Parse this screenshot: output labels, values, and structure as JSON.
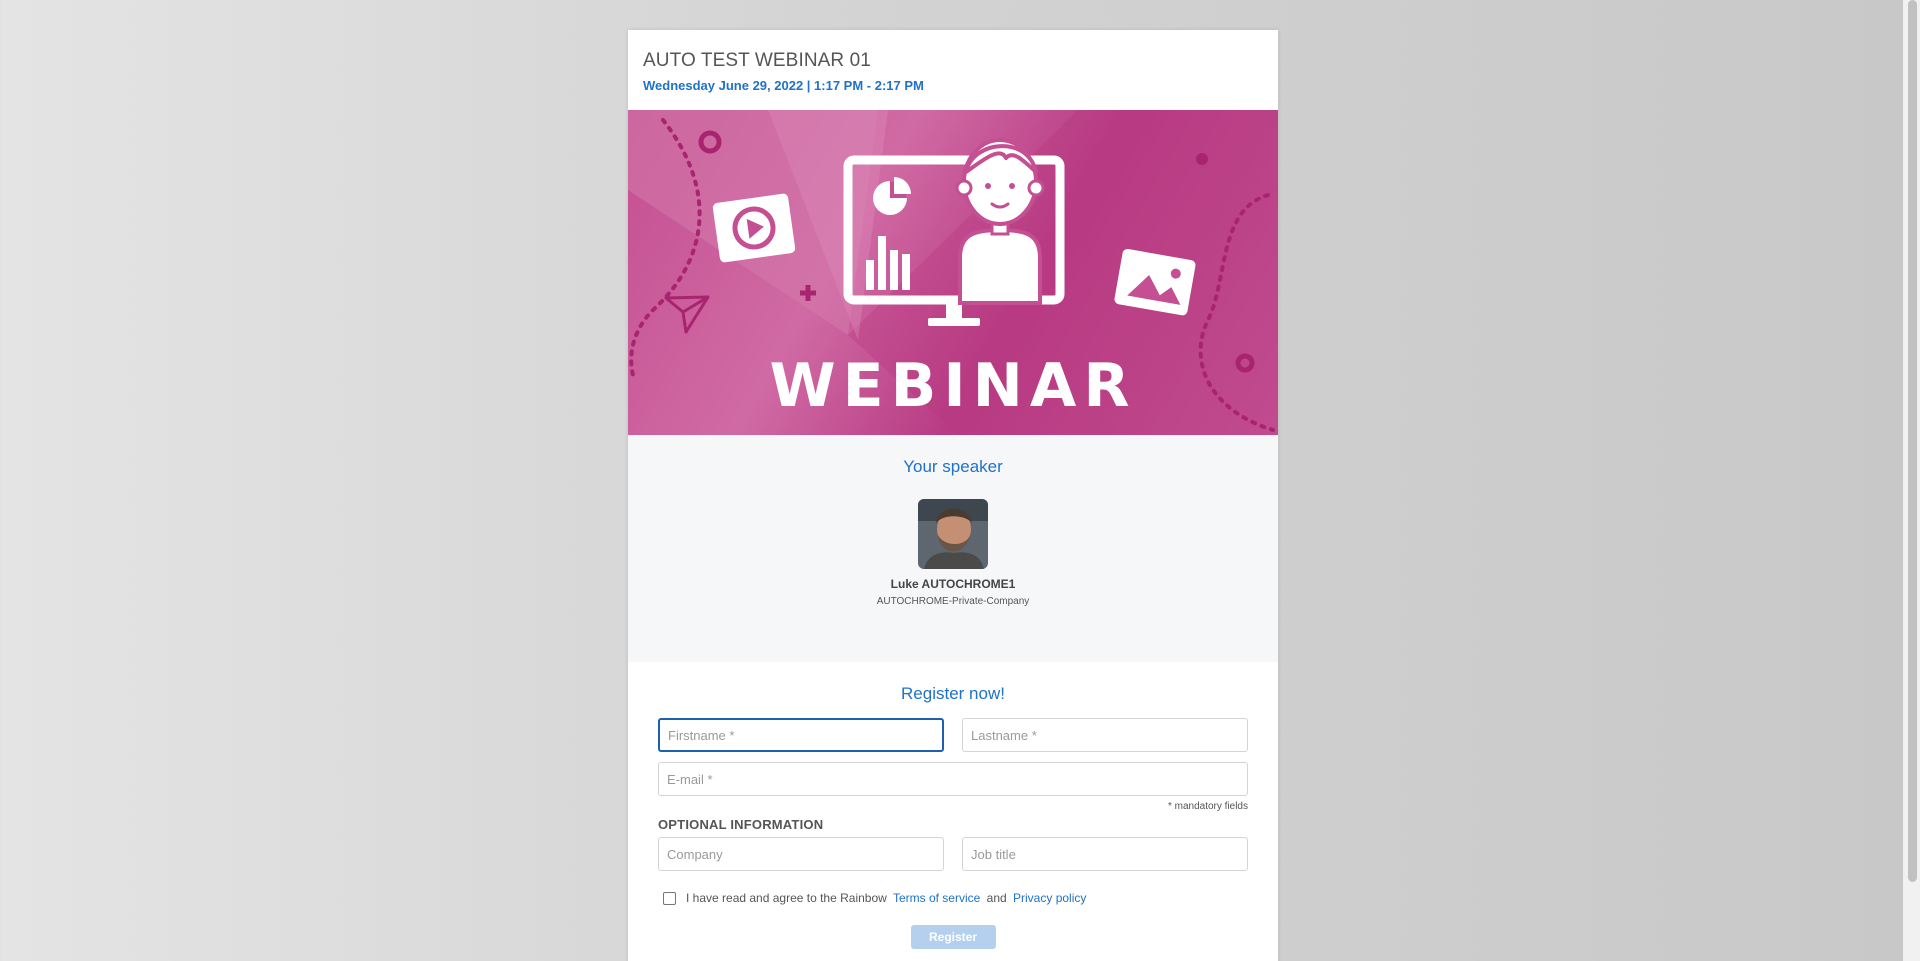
{
  "event": {
    "title": "AUTO TEST WEBINAR 01",
    "date": "Wednesday June 29, 2022 | 1:17 PM - 2:17 PM"
  },
  "banner": {
    "text": "WEBINAR",
    "colors": {
      "base": "#c44f92",
      "light": "#d06aa4",
      "dark": "#b83c84"
    }
  },
  "speaker_section": {
    "title": "Your speaker",
    "speaker": {
      "name": "Luke AUTOCHROME1",
      "company": "AUTOCHROME-Private-Company"
    }
  },
  "register": {
    "title": "Register now!",
    "firstname_placeholder": "Firstname *",
    "lastname_placeholder": "Lastname *",
    "email_placeholder": "E-mail *",
    "mandatory_note": "* mandatory fields",
    "optional_label": "OPTIONAL INFORMATION",
    "company_placeholder": "Company",
    "jobtitle_placeholder": "Job title",
    "terms": {
      "prefix": "I have read and agree to the Rainbow",
      "terms_link": "Terms of service",
      "conjunction": "and",
      "privacy_link": "Privacy policy"
    },
    "button_label": "Register"
  },
  "colors": {
    "accent": "#1f72c9",
    "button_disabled": "#b5d0ef"
  }
}
